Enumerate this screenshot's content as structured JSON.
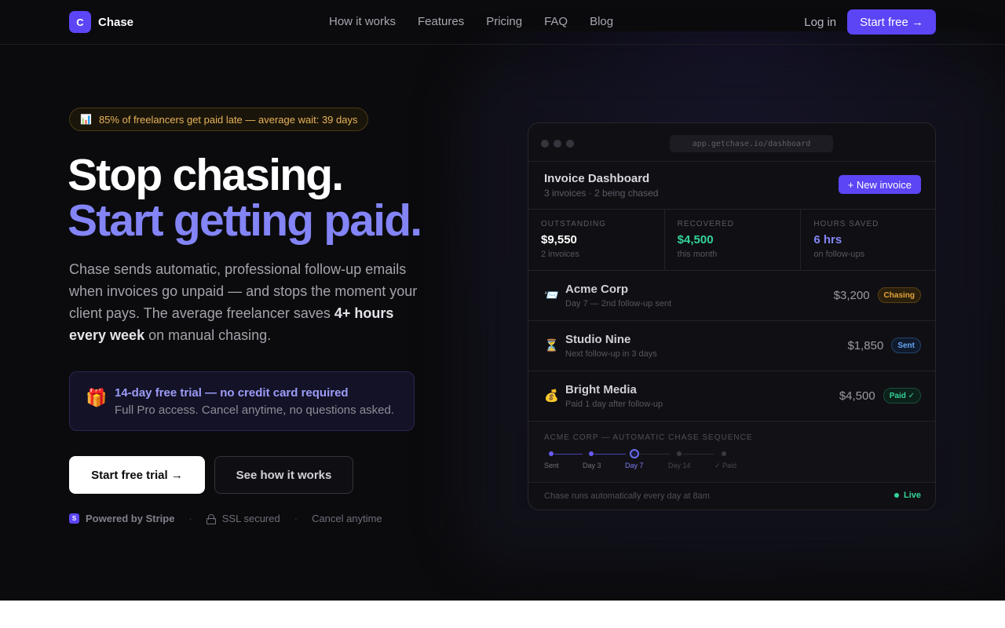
{
  "nav": {
    "brand_initial": "C",
    "brand_name": "Chase",
    "links": [
      "How it works",
      "Features",
      "Pricing",
      "FAQ",
      "Blog"
    ],
    "login_label": "Log in",
    "start_label": "Start free →"
  },
  "hero": {
    "stat_pill": "85% of freelancers get paid late — average wait: 39 days",
    "headline_line1": "Stop chasing.",
    "headline_line2": "Start getting paid.",
    "description_part1": "Chase sends automatic, professional follow-up emails when invoices go unpaid — and stops the moment your client pays. The average freelancer saves ",
    "description_strong": "4+ hours every week",
    "description_part2": " on manual chasing.",
    "trial_title": "14-day free trial — no credit card required",
    "trial_subtitle": "Full Pro access. Cancel anytime, no questions asked.",
    "cta_primary": "Start free trial →",
    "cta_secondary": "See how it works",
    "trust": {
      "stripe_mark": "S",
      "stripe_text": "Powered by Stripe",
      "ssl_text": "SSL secured",
      "cancel_text": "Cancel anytime"
    }
  },
  "dashboard": {
    "url": "app.getchase.io/dashboard",
    "title": "Invoice Dashboard",
    "subtitle": "3 invoices · 2 being chased",
    "new_invoice_label": "+ New invoice",
    "metrics": [
      {
        "label": "OUTSTANDING",
        "value": "$9,550",
        "sub": "2 invoices",
        "color": "#ffffff"
      },
      {
        "label": "RECOVERED",
        "value": "$4,500",
        "sub": "this month",
        "color": "#34d399"
      },
      {
        "label": "HOURS SAVED",
        "value": "6 hrs",
        "sub": "on follow-ups",
        "color": "#8384f6"
      }
    ],
    "invoices": [
      {
        "icon": "📨",
        "name": "Acme Corp",
        "note": "Day 7 — 2nd follow-up sent",
        "amount": "$3,200",
        "badge": "Chasing",
        "badge_fg": "#e3a33a",
        "badge_bg": "#2a1f0c",
        "badge_border": "#5a4214"
      },
      {
        "icon": "⏳",
        "name": "Studio Nine",
        "note": "Next follow-up in 3 days",
        "amount": "$1,850",
        "badge": "Sent",
        "badge_fg": "#6aa6f5",
        "badge_bg": "#0f1a2c",
        "badge_border": "#24406a"
      },
      {
        "icon": "💰",
        "name": "Bright Media",
        "note": "Paid 1 day after follow-up",
        "amount": "$4,500",
        "badge": "Paid ✓",
        "badge_fg": "#34d399",
        "badge_bg": "#0b2119",
        "badge_border": "#1a4d38"
      }
    ],
    "sequence": {
      "title": "ACME CORP — AUTOMATIC CHASE SEQUENCE",
      "steps": [
        "Sent",
        "Day 3",
        "Day 7",
        "Day 14",
        "✓ Paid"
      ],
      "current_step": 2
    },
    "footer_text": "Chase runs automatically every day at 8am",
    "live_label": "Live"
  },
  "colors": {
    "accent": "#5b45f5",
    "headline_accent": "#8384f6",
    "background": "#0b0b0e"
  }
}
